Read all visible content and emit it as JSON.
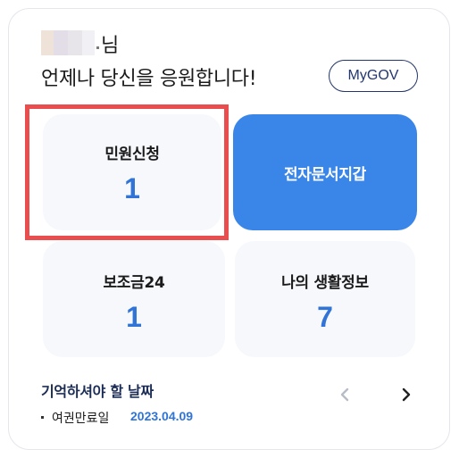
{
  "header": {
    "honorific": "님",
    "greeting": "언제나 당신을 응원합니다!",
    "mygov_label": "MyGOV"
  },
  "tiles": {
    "civil_petition": {
      "label": "민원신청",
      "count": "1"
    },
    "digital_wallet": {
      "label": "전자문서지갑"
    },
    "subsidy": {
      "label": "보조금24",
      "count": "1"
    },
    "life_info": {
      "label": "나의 생활정보",
      "count": "7"
    }
  },
  "reminders": {
    "title": "기억하셔야 할 날짜",
    "items": [
      {
        "label": "여권만료일",
        "date": "2023.04.09"
      }
    ]
  },
  "colors": {
    "accent_blue": "#2f74d6",
    "wallet_tile": "#3a86e8",
    "highlight_red": "#ea4d4d",
    "navy": "#23366d",
    "tile_bg": "#f6f8fc"
  },
  "icons": {
    "prev": "chevron-left-icon",
    "next": "chevron-right-icon"
  }
}
